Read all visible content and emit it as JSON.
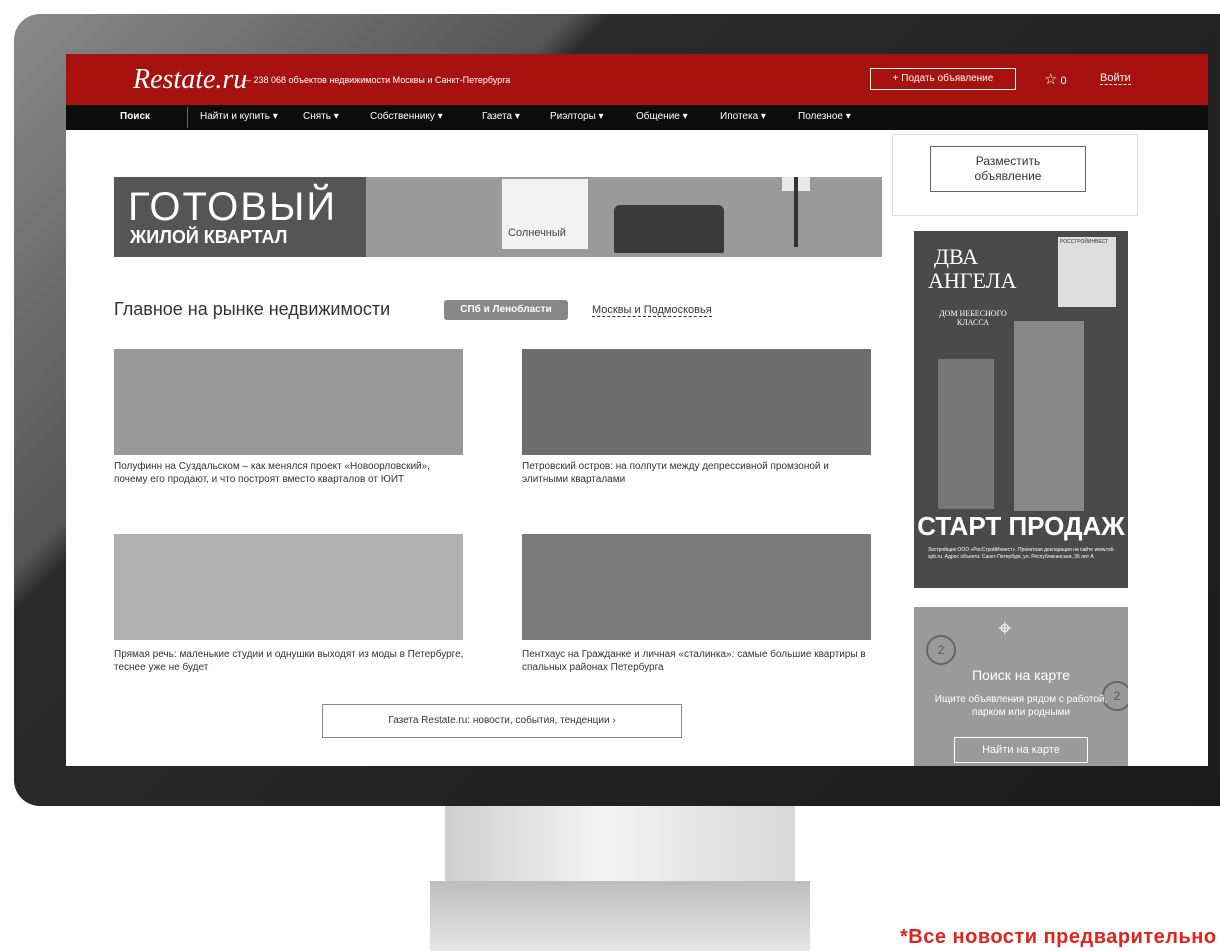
{
  "header": {
    "logo": "Restate.ru",
    "tagline": "— 238 068 объектов недвижимости Москвы и Санкт-Петербурга",
    "post_button": "+ Подать объявление",
    "favorites_count": "0",
    "login": "Войти"
  },
  "nav": {
    "items": [
      {
        "label": "Поиск"
      },
      {
        "label": "Найти и купить ▾"
      },
      {
        "label": "Снять ▾"
      },
      {
        "label": "Собственнику ▾"
      },
      {
        "label": "Газета ▾"
      },
      {
        "label": "Риэлторы ▾"
      },
      {
        "label": "Общение ▾"
      },
      {
        "label": "Ипотека ▾"
      },
      {
        "label": "Полезное ▾"
      }
    ]
  },
  "banner": {
    "line1": "ГОТОВЫЙ",
    "line2": "ЖИЛОЙ КВАРТАЛ",
    "brand": "Солнечный"
  },
  "main": {
    "title": "Главное на рынке недвижимости",
    "tab_active": "СПб и Ленобласти",
    "tab_other": "Москвы и Подмосковья",
    "cards": [
      {
        "text": "Полуфинн на Суздальском – как менялся проект «Новоорловский», почему его продают, и что построят вместо кварталов от ЮИТ"
      },
      {
        "text": "Петровский остров: на полпути между депрессивной промзоной и элитными кварталами"
      },
      {
        "text": "Прямая речь: маленькие студии и однушки выходят из моды в Петербурге, теснее уже не будет"
      },
      {
        "text": "Пентхаус на Гражданке и личная «сталинка»: самые большие квартиры в спальных районах Петербурга"
      }
    ],
    "more_button": "Газета Restate.ru: новости, события, тенденции   ›"
  },
  "sidebar": {
    "place_button_line1": "Разместить",
    "place_button_line2": "объявление",
    "ad": {
      "title_line1": "ДВА",
      "title_line2": "АНГЕЛА",
      "subtitle": "ДОМ НЕБЕСНОГО КЛАССА",
      "developer": "РОССТРОЙИНВЕСТ",
      "cta": "СТАРТ ПРОДАЖ",
      "fine_print": "Застройщик ООО «РосСтройИнвест». Проектная декларация на сайте www.rsti-spb.ru. Адрес объекта: Санкт-Петербург, ул. Республиканская, 35 лит А"
    },
    "map": {
      "title": "Поиск на карте",
      "description": "Ищите объявления рядом с работой, парком или родными",
      "button": "Найти на карте",
      "markers": [
        "2",
        "2"
      ]
    }
  },
  "footnote": "*Все новости предварительно",
  "colors": {
    "header_red": "#a8120e",
    "nav_black": "#0c0c0c",
    "footnote_red": "#e2231a"
  }
}
